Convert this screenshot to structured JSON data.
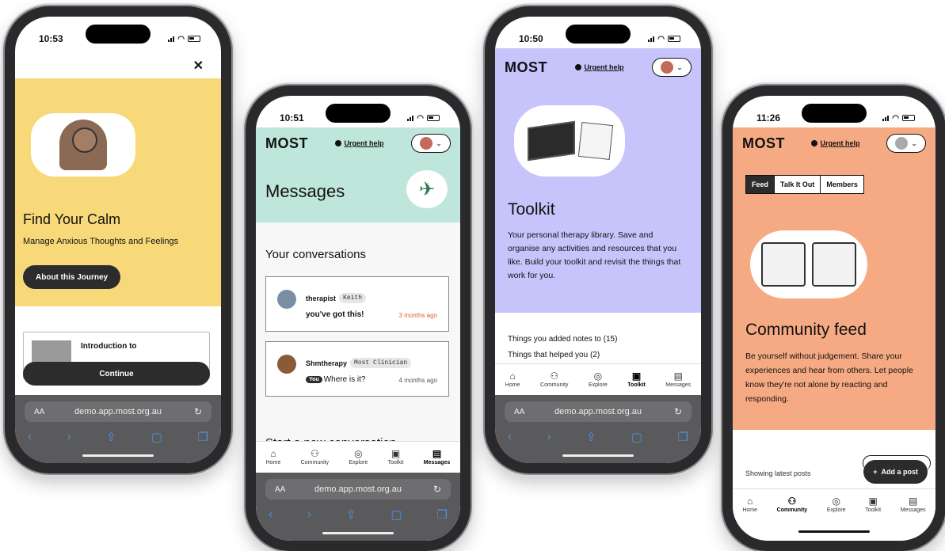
{
  "phone1": {
    "time": "10:53",
    "title": "Find Your Calm",
    "subtitle": "Manage Anxious Thoughts and Feelings",
    "about_button": "About this Journey",
    "intro_card": "Introduction to",
    "continue_button": "Continue",
    "url": "demo.app.most.org.au",
    "close_label": "✕"
  },
  "phone2": {
    "time": "10:51",
    "logo": "MOST",
    "urgent": "Urgent help",
    "title": "Messages",
    "conversations_title": "Your conversations",
    "conversations": [
      {
        "name": "therapist",
        "tag": "Keith",
        "message": "you've got this!",
        "time": "3 months ago"
      },
      {
        "name": "Shmtherapy",
        "tag": "Most Clinician",
        "you": "You",
        "message": "Where is it?",
        "time": "4 months ago"
      }
    ],
    "start_title": "Start a new conversation",
    "tabs": [
      "Home",
      "Community",
      "Explore",
      "Toolkit",
      "Messages"
    ],
    "url": "demo.app.most.org.au"
  },
  "phone3": {
    "time": "10:50",
    "logo": "MOST",
    "urgent": "Urgent help",
    "title": "Toolkit",
    "description": "Your personal therapy library. Save and organise any activities and resources that you like. Build your toolkit and revisit the things that work for you.",
    "list": [
      "Things you added notes to (15)",
      "Things that helped you (2)"
    ],
    "tabs": [
      "Home",
      "Community",
      "Explore",
      "Toolkit",
      "Messages"
    ],
    "url": "demo.app.most.org.au"
  },
  "phone4": {
    "time": "11:26",
    "logo": "MOST",
    "urgent": "Urgent help",
    "segments": [
      "Feed",
      "Talk It Out",
      "Members"
    ],
    "title": "Community feed",
    "description": "Be yourself without judgement. Share your experiences and hear from others. Let people know they're not alone by reacting and responding.",
    "latest": "Showing latest posts",
    "add_post": "Add a post",
    "tabs": [
      "Home",
      "Community",
      "Explore",
      "Toolkit",
      "Messages"
    ]
  },
  "colors": {
    "yellow": "#f8d97a",
    "mint": "#bfe6da",
    "lavender": "#c7c4fb",
    "peach": "#f6aa83",
    "dark_button": "#2c2c2c",
    "accent_red": "#e35b3a"
  }
}
